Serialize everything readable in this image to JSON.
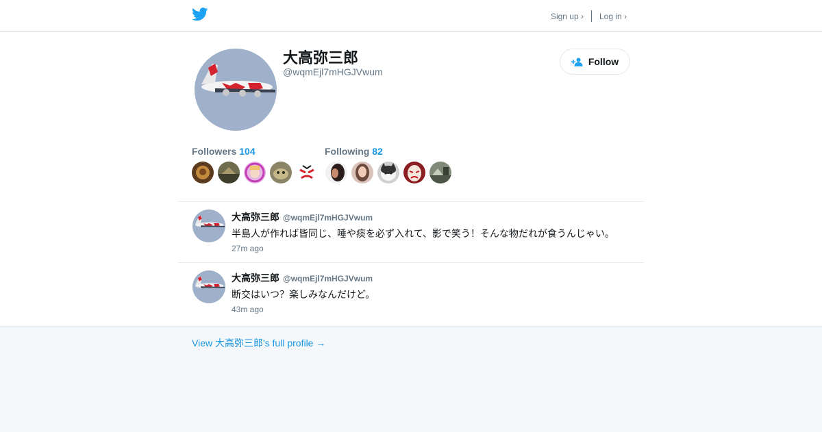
{
  "header": {
    "logo_icon": "twitter-bird-icon",
    "signup_label": "Sign up ›",
    "login_label": "Log in ›"
  },
  "profile": {
    "name": "大高弥三郎",
    "handle": "@wqmEjl7mHGJVwum",
    "avatar_icon": "airplane-avatar",
    "follow_label": "Follow",
    "followers_label": "Followers",
    "followers_count": "104",
    "following_label": "Following",
    "following_count": "82"
  },
  "tweets": [
    {
      "name": "大高弥三郎",
      "handle": "@wqmEjl7mHGJVwum",
      "text": "半島人が作れば皆同じ、唾や痰を必ず入れて、影で笑う！そんな物だれが食うんじゃい。",
      "time": "27m ago"
    },
    {
      "name": "大高弥三郎",
      "handle": "@wqmEjl7mHGJVwum",
      "text": "断交はいつ？楽しみなんだけど。",
      "time": "43m ago"
    }
  ],
  "footer": {
    "full_profile_link": "View 大高弥三郎's full profile →"
  },
  "colors": {
    "accent": "#1b95e0",
    "twitter_blue": "#1da1f2",
    "muted": "#657786",
    "footer_bg": "#f5f8fa"
  }
}
